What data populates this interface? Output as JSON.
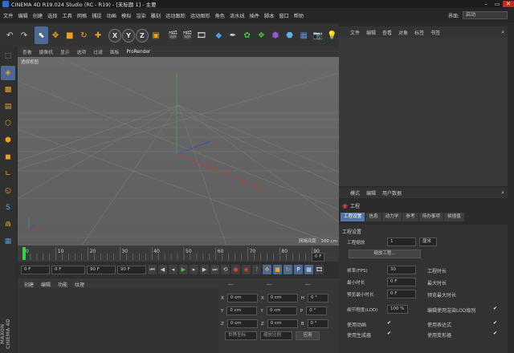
{
  "app": {
    "title": "CINEMA 4D R19.024 Studio (RC - R19) - [未标题 1] - 主要"
  },
  "menu": {
    "items": [
      "文件",
      "编辑",
      "创建",
      "选择",
      "工具",
      "网格",
      "捕捉",
      "动画",
      "模拟",
      "渲染",
      "雕刻",
      "运动跟踪",
      "运动图形",
      "角色",
      "流水线",
      "插件",
      "脚本",
      "窗口",
      "帮助"
    ],
    "layout_label": "界面:",
    "layout_value": "启动"
  },
  "viewport": {
    "menu": [
      "查看",
      "摄像机",
      "显示",
      "选项",
      "过滤",
      "面板",
      "ProRender"
    ],
    "camera_label": "透视视图",
    "grid_label": "网格间距 : 100 cm"
  },
  "timeline": {
    "ticks": [
      "0",
      "10",
      "20",
      "30",
      "40",
      "50",
      "60",
      "70",
      "80",
      "90"
    ],
    "end_frame": "0 F",
    "progress": 0
  },
  "transport": {
    "start": "0 F",
    "current": "0 F",
    "preview_end": "90 F",
    "end": "90 F"
  },
  "material": {
    "menu": [
      "创建",
      "编辑",
      "功能",
      "纹理"
    ]
  },
  "coords": {
    "labels": [
      "X",
      "Y",
      "Z"
    ],
    "values": [
      "0 cm",
      "0 cm",
      "0 cm"
    ],
    "rot": [
      "0 cm",
      "0 cm",
      "0 cm"
    ],
    "rot_labels": [
      "H",
      "P",
      "B"
    ],
    "rot_values": [
      "0 °",
      "0 °",
      "0 °"
    ],
    "mode1": "世界坐标",
    "mode2": "缩放比例",
    "apply": "应用",
    "dashes": "---"
  },
  "objects": {
    "menu": [
      "文件",
      "编辑",
      "查看",
      "对象",
      "标签",
      "书签"
    ]
  },
  "attributes": {
    "menu": [
      "模式",
      "编辑",
      "用户数据"
    ],
    "title": "工程",
    "tabs": [
      "工程设置",
      "信息",
      "动力学",
      "参考",
      "待办事项",
      "帧插值"
    ],
    "section": "工程设置",
    "scale_label": "工程缩放",
    "scale_value": "1",
    "scale_unit": "厘米",
    "scale_button": "缩放工程...",
    "fps_label": "帧率(FPS)",
    "fps_value": "30",
    "project_len_label": "工程时长",
    "min_label": "最小时长",
    "min_value": "0 F",
    "max_label": "最大时长",
    "preview_min_label": "预览最小时长",
    "preview_min_value": "0 F",
    "preview_max_label": "预览最大时长",
    "lod_label": "细节程度(LOD)",
    "lod_value": "100 %",
    "lod_render_label": "编辑使用渲染LOD级别",
    "anim_label": "使用动画",
    "expr_label": "使用表达式",
    "gen_label": "使用生成器",
    "deform_label": "使用变形器"
  },
  "logo": "MAXON CINEMA 4D"
}
